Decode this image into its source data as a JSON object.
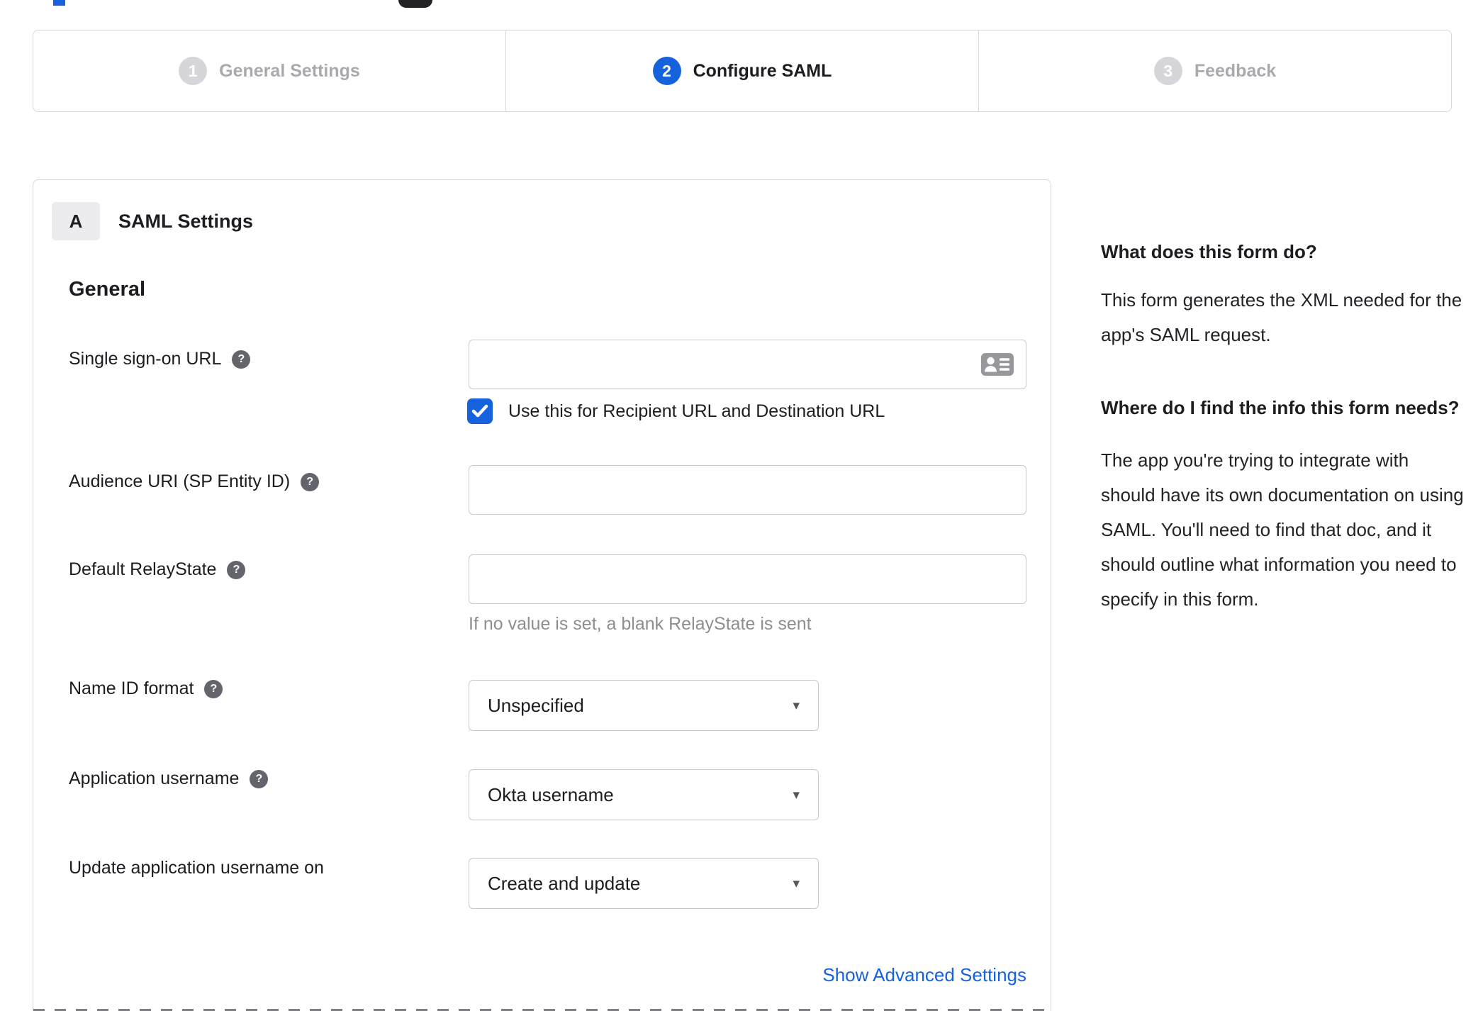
{
  "stepper": {
    "steps": [
      {
        "number": "1",
        "label": "General Settings",
        "state": "inactive"
      },
      {
        "number": "2",
        "label": "Configure SAML",
        "state": "active"
      },
      {
        "number": "3",
        "label": "Feedback",
        "state": "inactive"
      }
    ]
  },
  "panel": {
    "section_badge": "A",
    "section_title": "SAML Settings",
    "subsection_title": "General",
    "fields": {
      "sso_url": {
        "label": "Single sign-on URL",
        "value": "",
        "checkbox_label": "Use this for Recipient URL and Destination URL",
        "checkbox_checked": true
      },
      "audience_uri": {
        "label": "Audience URI (SP Entity ID)",
        "value": ""
      },
      "default_relaystate": {
        "label": "Default RelayState",
        "value": "",
        "hint": "If no value is set, a blank RelayState is sent"
      },
      "name_id_format": {
        "label": "Name ID format",
        "value": "Unspecified"
      },
      "app_username": {
        "label": "Application username",
        "value": "Okta username"
      },
      "update_app_username": {
        "label": "Update application username on",
        "value": "Create and update"
      }
    },
    "advanced_link": "Show Advanced Settings"
  },
  "sidebar": {
    "heading1": "What does this form do?",
    "paragraph1": "This form generates the XML needed for the app's SAML request.",
    "heading2": "Where do I find the info this form needs?",
    "paragraph2": "The app you're trying to integrate with should have its own documentation on using SAML. You'll need to find that doc, and it should outline what information you need to specify in this form."
  },
  "icons": {
    "help_glyph": "?",
    "check_glyph": "✓",
    "caret_glyph": "▾"
  },
  "colors": {
    "accent_blue": "#1662dd",
    "inactive_gray": "#aaaaae",
    "border_gray": "#d8d8dc",
    "hint_gray": "#8e8e92"
  }
}
